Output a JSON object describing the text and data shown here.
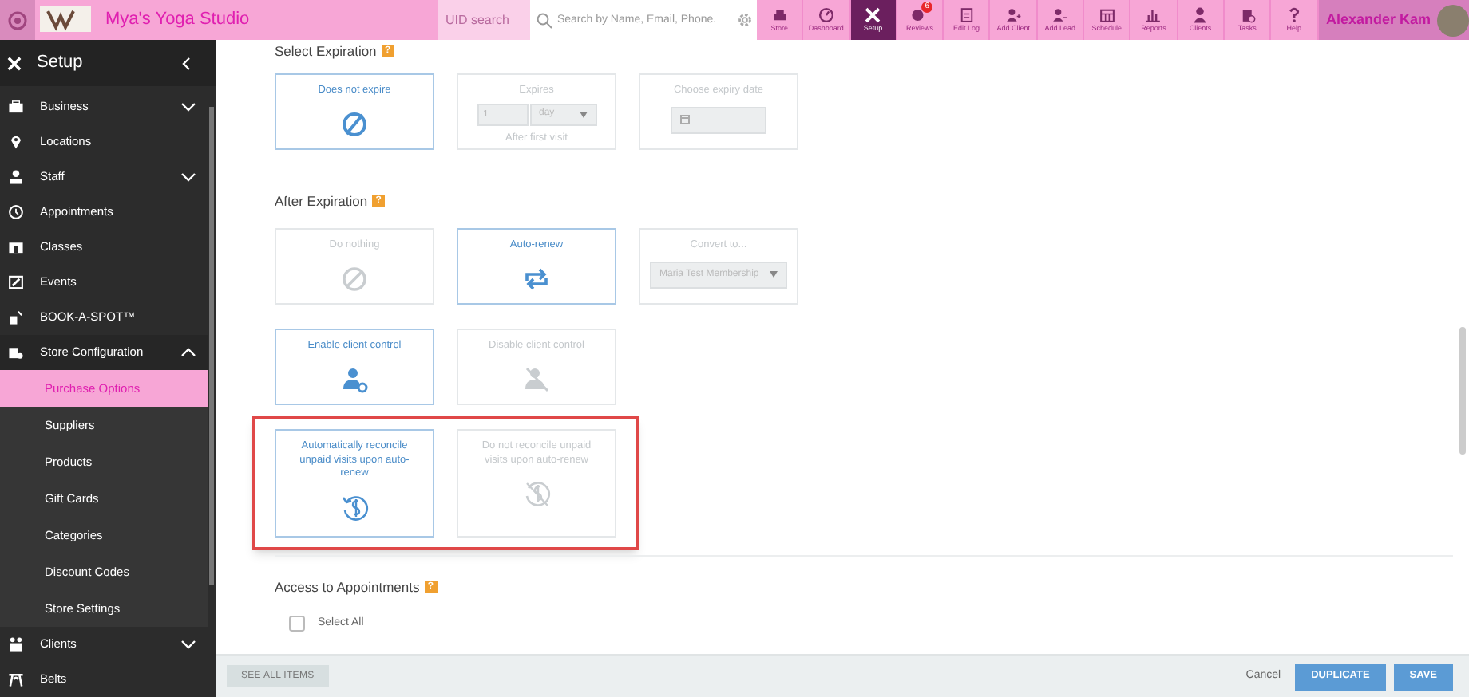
{
  "topbar": {
    "studio_name": "Mya's Yoga Studio",
    "uid_placeholder": "UID search",
    "search_placeholder": "Search by Name, Email, Phone.",
    "nav": [
      {
        "label": "Store",
        "selected": false
      },
      {
        "label": "Dashboard",
        "selected": false
      },
      {
        "label": "Setup",
        "selected": true
      },
      {
        "label": "Reviews",
        "selected": false,
        "badge": "6"
      },
      {
        "label": "Edit Log",
        "selected": false
      },
      {
        "label": "Add Client",
        "selected": false
      },
      {
        "label": "Add Lead",
        "selected": false
      },
      {
        "label": "Schedule",
        "selected": false
      },
      {
        "label": "Reports",
        "selected": false
      },
      {
        "label": "Clients",
        "selected": false
      },
      {
        "label": "Tasks",
        "selected": false
      },
      {
        "label": "Help",
        "selected": false
      }
    ],
    "user_name": "Alexander Kam"
  },
  "sidebar": {
    "title": "Setup",
    "items": [
      {
        "label": "Business",
        "expanded": false
      },
      {
        "label": "Locations"
      },
      {
        "label": "Staff",
        "expanded": false
      },
      {
        "label": "Appointments"
      },
      {
        "label": "Classes"
      },
      {
        "label": "Events"
      },
      {
        "label": "BOOK-A-SPOT™"
      },
      {
        "label": "Store Configuration",
        "expanded": true,
        "children": [
          {
            "label": "Purchase Options",
            "selected": true
          },
          {
            "label": "Suppliers",
            "selected": false
          },
          {
            "label": "Products",
            "selected": false
          },
          {
            "label": "Gift Cards",
            "selected": false
          },
          {
            "label": "Categories",
            "selected": false
          },
          {
            "label": "Discount Codes",
            "selected": false
          },
          {
            "label": "Store Settings",
            "selected": false
          }
        ]
      },
      {
        "label": "Clients",
        "expanded": false
      },
      {
        "label": "Belts"
      }
    ]
  },
  "sections": [
    {
      "title": "Select Expiration",
      "help": "?",
      "rows": [
        {
          "highlighted": false,
          "options": [
            {
              "kind": "icon",
              "label": "Does not expire",
              "selected": true
            },
            {
              "kind": "duration",
              "label": "Expires",
              "amount": "1",
              "unit": "day",
              "caption": "After first visit",
              "selected": false
            },
            {
              "kind": "date",
              "label": "Choose expiry date",
              "selected": false
            }
          ]
        }
      ]
    },
    {
      "title": "After Expiration",
      "help": "?",
      "rows": [
        {
          "highlighted": false,
          "options": [
            {
              "kind": "icon",
              "label": "Do nothing",
              "selected": false
            },
            {
              "kind": "icon",
              "label": "Auto-renew",
              "selected": true
            },
            {
              "kind": "convert",
              "label": "Convert to...",
              "value": "Maria Test Membership",
              "selected": false
            }
          ]
        },
        {
          "highlighted": false,
          "options": [
            {
              "kind": "icon",
              "label": "Enable client control",
              "selected": true
            },
            {
              "kind": "icon",
              "label": "Disable client control",
              "selected": false
            }
          ]
        },
        {
          "highlighted": true,
          "options": [
            {
              "kind": "icon",
              "label": "Automatically reconcile unpaid visits upon auto-renew",
              "selected": true
            },
            {
              "kind": "icon",
              "label": "Do not reconcile unpaid visits upon auto-renew",
              "selected": false
            }
          ]
        }
      ]
    }
  ],
  "access": {
    "title": "Access to Appointments",
    "help": "?",
    "select_all": {
      "label": "Select All",
      "checked": false
    }
  },
  "footer": {
    "see_all": "SEE ALL ITEMS",
    "cancel": "Cancel",
    "duplicate": "DUPLICATE",
    "save": "SAVE"
  }
}
